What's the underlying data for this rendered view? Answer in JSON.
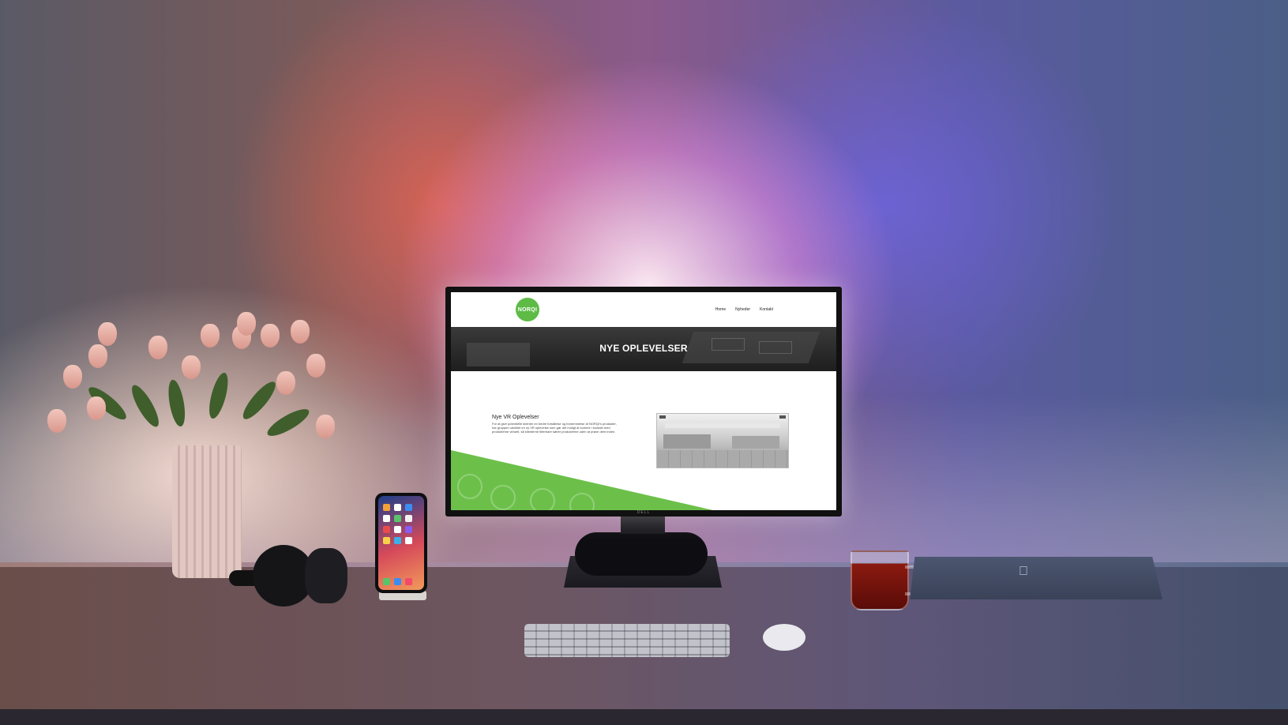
{
  "website": {
    "logo_text": "NORQI",
    "nav": [
      "Home",
      "Nyheder",
      "Kontakt"
    ],
    "hero_title": "NYE OPLEVELSER",
    "section_heading": "Nye VR Oplevelser",
    "section_body": "For at give potentielle kleinter en bedre forståelse og fornemmelse af NORQI's produkter, har gruppen udviklet en ny VR oplevelse som gør det muligt at komme i kontakt med produkterne virtuelt, så klienterne tilterbare køber produkterne uden at prøve dem inden."
  },
  "monitor": {
    "brand": "DELL"
  },
  "colors": {
    "brand_green": "#5dbb46",
    "hero_bg": "#2a2a2a",
    "wedge_green": "#6cc04a"
  }
}
